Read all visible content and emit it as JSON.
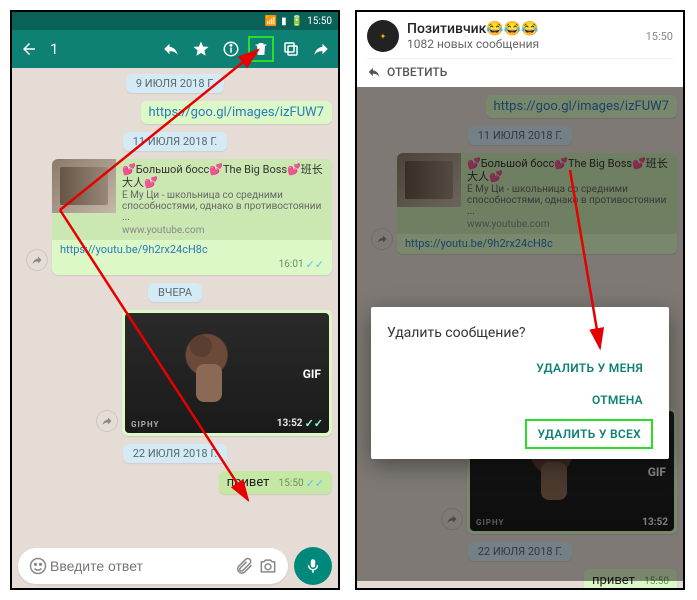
{
  "status": {
    "time": "15:50"
  },
  "selection": {
    "count": "1"
  },
  "left": {
    "dates": {
      "d1": "9 ИЮЛЯ 2018 Г.",
      "d2": "11 ИЮЛЯ 2018 Г.",
      "d3": "ВЧЕРА",
      "d4": "22 ИЮЛЯ 2018 Г."
    },
    "msg1": {
      "link": "https://goo.gl/images/izFUW7"
    },
    "yt": {
      "title": "💕Большой босс💕The Big Boss💕班长大人💕",
      "desc": "Е Му Ци - школьница со средними способностями, однако в противостоянии ...",
      "domain": "www.youtube.com",
      "link": "https://youtu.be/9h2rx24cH8c",
      "time": "16:01"
    },
    "gif": {
      "label": "GIF",
      "brand": "GIPHY",
      "time": "13:52"
    },
    "msg2": {
      "text": "привет",
      "time": "15:50"
    },
    "input": {
      "placeholder": "Введите ответ"
    }
  },
  "right": {
    "notif": {
      "title": "Позитивчик😂😂😂",
      "sub": "1082 новых сообщения",
      "time": "15:50",
      "reply": "ОТВЕТИТЬ"
    },
    "dialog": {
      "title": "Удалить сообщение?",
      "b1": "УДАЛИТЬ У МЕНЯ",
      "b2": "ОТМЕНА",
      "b3": "УДАЛИТЬ У ВСЕХ"
    },
    "dates": {
      "d2": "11 ИЮЛЯ 2018 Г.",
      "d4": "22 ИЮЛЯ 2018 Г."
    },
    "msg2": {
      "text": "привет",
      "time": "15:50"
    }
  }
}
